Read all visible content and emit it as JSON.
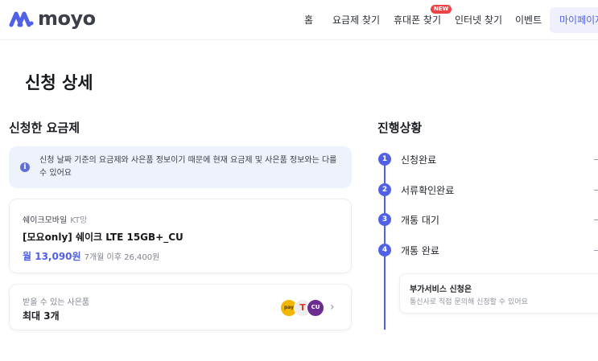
{
  "brand": {
    "name": "moyo",
    "logo_color": "#5161e6"
  },
  "nav": {
    "items": [
      {
        "label": "홈"
      },
      {
        "label": "요금제 찾기"
      },
      {
        "label": "휴대폰 찾기",
        "badge": "NEW"
      },
      {
        "label": "인터넷 찾기"
      },
      {
        "label": "이벤트"
      },
      {
        "label": "마이페이지",
        "active": true
      }
    ]
  },
  "page_title": "신청 상세",
  "plan_section": {
    "title": "신청한 요금제",
    "notice": {
      "icon": "info-icon",
      "text": "신청 날짜 기준의 요금제와 사은품 정보이기 때문에 현재 요금제 및 사은품 정보와는 다를 수 있어요"
    },
    "plan": {
      "carrier": "쉐이크모바일",
      "network": "KT망",
      "name": "[모요only] 쉐이크 LTE 15GB+_CU",
      "price": "월 13,090원",
      "after_price": "7개월 이후 26,400원"
    },
    "gift": {
      "label": "받을 수 있는 사은품",
      "value": "최대 3개",
      "icons": [
        "gift-brand-icon",
        "t-brand-icon",
        "cu-brand-icon"
      ],
      "icon_texts": [
        "pay",
        "T",
        "CU"
      ]
    }
  },
  "progress_section": {
    "title": "진행상황",
    "steps": [
      {
        "num": "1",
        "label": "신청완료"
      },
      {
        "num": "2",
        "label": "서류확인완료"
      },
      {
        "num": "3",
        "label": "개통 대기"
      },
      {
        "num": "4",
        "label": "개통 완료"
      }
    ],
    "addon": {
      "title": "부가서비스 신청은",
      "desc": "통신사로 직접 문의해 신청할 수 있어요"
    }
  },
  "colors": {
    "accent": "#5161e6",
    "notice_bg": "#eef2fb",
    "badge_red": "#ef4444"
  }
}
